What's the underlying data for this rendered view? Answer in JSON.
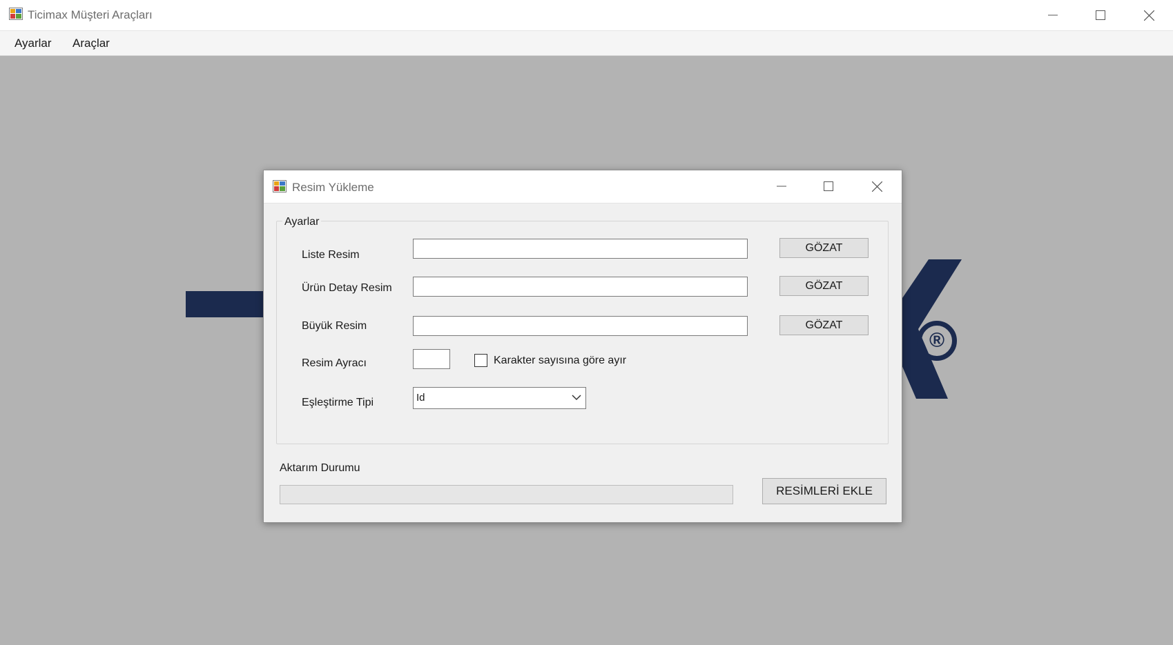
{
  "app": {
    "title": "Ticimax Müşteri Araçları",
    "icon": "app-window-icon"
  },
  "menu": {
    "items": [
      {
        "label": "Ayarlar"
      },
      {
        "label": "Araçlar"
      }
    ]
  },
  "background_logo": {
    "registered_mark": "®"
  },
  "dialog": {
    "title": "Resim Yükleme",
    "group": {
      "title": "Ayarlar",
      "fields": {
        "liste_resim": {
          "label": "Liste Resim",
          "value": "",
          "browse_label": "GÖZAT"
        },
        "urun_detay_resim": {
          "label": "Ürün Detay Resim",
          "value": "",
          "browse_label": "GÖZAT"
        },
        "buyuk_resim": {
          "label": "Büyük Resim",
          "value": "",
          "browse_label": "GÖZAT"
        },
        "resim_ayraci": {
          "label": "Resim Ayracı",
          "value": ""
        },
        "karakter_checkbox": {
          "label": "Karakter sayısına göre ayır",
          "checked": false
        },
        "eslestirme_tipi": {
          "label": "Eşleştirme Tipi",
          "selected": "Id"
        }
      }
    },
    "transfer_status": {
      "label": "Aktarım Durumu",
      "progress": 0
    },
    "submit_label": "RESİMLERİ EKLE"
  },
  "colors": {
    "logo_navy": "#1b2a4e",
    "background_gray": "#b3b3b3",
    "dialog_bg": "#f0f0f0"
  }
}
